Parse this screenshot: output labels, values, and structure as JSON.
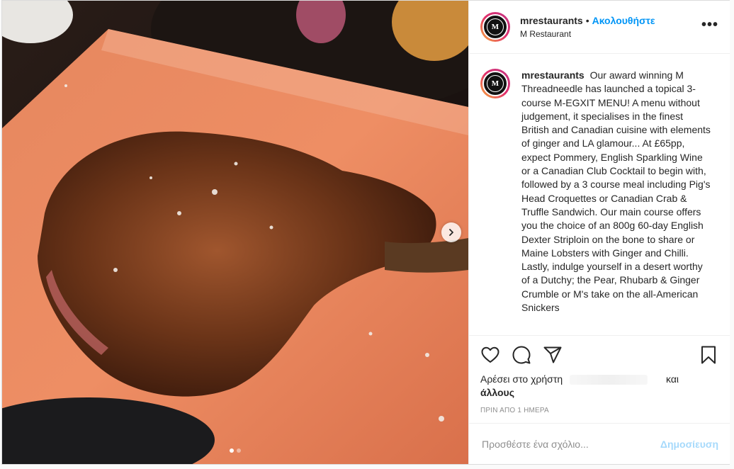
{
  "header": {
    "username": "mrestaurants",
    "separator": "•",
    "follow_label": "Ακολουθήστε",
    "location": "M Restaurant",
    "more_label": "•••",
    "avatar_letter": "M"
  },
  "caption": {
    "username": "mrestaurants",
    "text": "Our award winning M Threadneedle has launched a topical 3-course M-EGXIT MENU! A menu without judgement, it specialises in the finest British and Canadian cuisine with elements of ginger and LA glamour... At £65pp, expect Pommery, English Sparkling Wine or a Canadian Club Cocktail to begin with, followed by a 3 course meal including Pig's Head Croquettes or Canadian Crab & Truffle Sandwich. Our main course offers you the choice of an 800g 60-day English Dexter Striploin on the bone to share or Maine Lobsters with Ginger and Chilli. Lastly, indulge yourself in a desert worthy of a Dutchy; the Pear, Rhubarb & Ginger Crumble or M's take on the all-American Snickers"
  },
  "likes": {
    "prefix": "Αρέσει στο χρήστη",
    "and": "και",
    "others": "άλλους"
  },
  "timestamp": "ΠΡΙΝ ΑΠΟ 1 ΗΜΕΡΑ",
  "comment": {
    "placeholder": "Προσθέστε ένα σχόλιο...",
    "post_label": "Δημοσίευση"
  },
  "carousel": {
    "slides": 2,
    "active": 1
  },
  "colors": {
    "accent": "#0095f6",
    "text": "#262626",
    "muted": "#8e8e8e",
    "border": "#efefef"
  },
  "icons": [
    "heart-icon",
    "comment-icon",
    "share-icon",
    "bookmark-icon",
    "chevron-right-icon",
    "more-icon"
  ]
}
